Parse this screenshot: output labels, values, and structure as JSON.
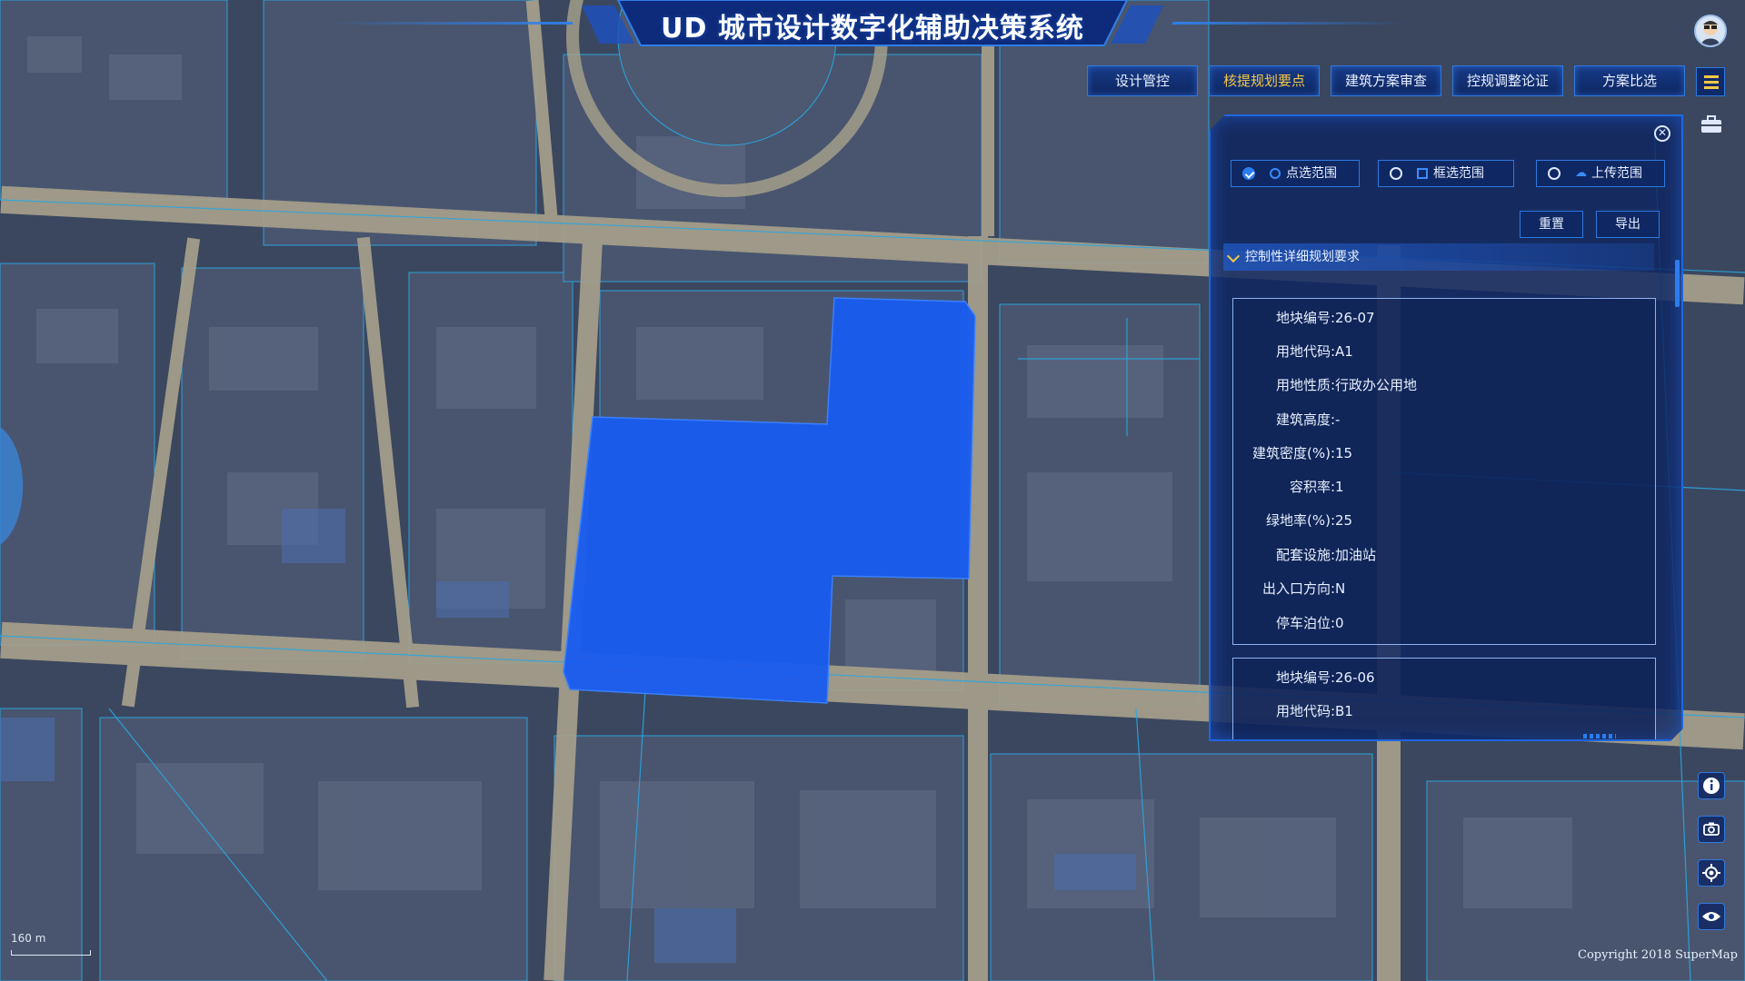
{
  "app": {
    "title": "UD 城市设计数字化辅助决策系统"
  },
  "nav": {
    "tabs": [
      {
        "label": "设计管控",
        "active": false
      },
      {
        "label": "核提规划要点",
        "active": true
      },
      {
        "label": "建筑方案审查",
        "active": false
      },
      {
        "label": "控规调整论证",
        "active": false
      },
      {
        "label": "方案比选",
        "active": false
      }
    ]
  },
  "panel": {
    "range_options": [
      {
        "label": "点选范围",
        "checked": true,
        "icon": "point-select-icon"
      },
      {
        "label": "框选范围",
        "checked": false,
        "icon": "box-select-icon"
      },
      {
        "label": "上传范围",
        "checked": false,
        "icon": "upload-icon"
      }
    ],
    "reset_label": "重置",
    "export_label": "导出",
    "section_title": "控制性详细规划要求",
    "parcels": [
      {
        "rows": [
          {
            "key": "地块编号:",
            "value": "26-07"
          },
          {
            "key": "用地代码:",
            "value": "A1"
          },
          {
            "key": "用地性质:",
            "value": "行政办公用地"
          },
          {
            "key": "建筑高度:",
            "value": "-"
          },
          {
            "key": "建筑密度(%):",
            "value": "15"
          },
          {
            "key": "容积率:",
            "value": "1"
          },
          {
            "key": "绿地率(%):",
            "value": "25"
          },
          {
            "key": "配套设施:",
            "value": "加油站"
          },
          {
            "key": "出入口方向:",
            "value": "N"
          },
          {
            "key": "停车泊位:",
            "value": "0"
          }
        ]
      },
      {
        "rows": [
          {
            "key": "地块编号:",
            "value": "26-06"
          },
          {
            "key": "用地代码:",
            "value": "B1"
          }
        ]
      }
    ]
  },
  "tools": [
    "info-icon",
    "camera-icon",
    "locate-icon",
    "eye-icon"
  ],
  "map": {
    "scale_label": "160 m",
    "copyright": "Copyright 2018 SuperMap",
    "selection_color": "#1a5cf0",
    "road_color": "#b3ac95",
    "block_color": "#4a5670"
  }
}
